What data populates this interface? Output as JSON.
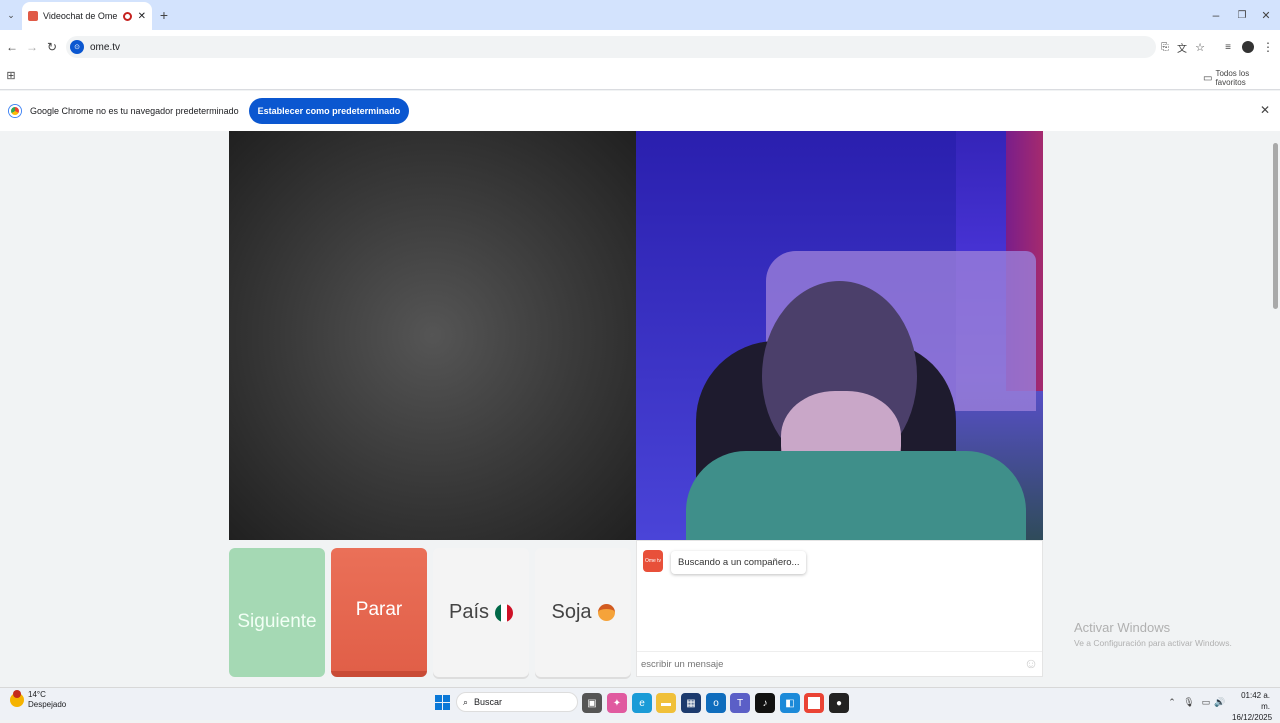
{
  "browser": {
    "tab_title": "Videochat de OmeTV: una",
    "url": "ome.tv",
    "bookmarks_label": "Todos los favoritos",
    "infobar_text": "Google Chrome no es tu navegador predeterminado",
    "infobar_button": "Establecer como predeterminado"
  },
  "app": {
    "next_label": "Siguiente",
    "stop_label": "Parar",
    "country_label": "País",
    "gender_label": "Soja",
    "chat_status": "Buscando a un compañero...",
    "chat_placeholder": "escribir un mensaje",
    "logo_text": "Ome tv"
  },
  "watermark": {
    "title": "Activar Windows",
    "subtitle": "Ve a Configuración para activar Windows."
  },
  "taskbar": {
    "temp": "14°C",
    "weather": "Despejado",
    "search": "Buscar",
    "time": "01:42 a. m.",
    "date": "16/12/2025"
  },
  "colors": {
    "next": "#a5d9b4",
    "stop": "#e86e52",
    "accent": "#0b57d0"
  }
}
